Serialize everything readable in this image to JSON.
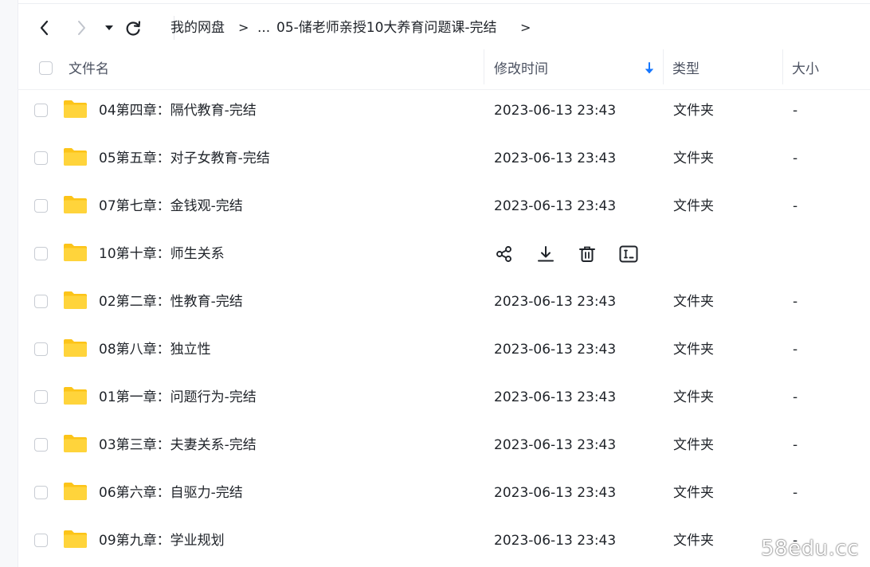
{
  "breadcrumb": {
    "root": "我的网盘",
    "sep1": ">",
    "ellipsis": "...",
    "current": "05-储老师亲授10大养育问题课-完结",
    "sep2": ">"
  },
  "nav": {
    "back_icon": "chevron-left-icon",
    "forward_icon": "chevron-right-icon",
    "dropdown_icon": "caret-down-icon",
    "refresh_icon": "refresh-icon"
  },
  "columns": {
    "name": "文件名",
    "modified": "修改时间",
    "type": "类型",
    "size": "大小",
    "sort_icon": "arrow-down-icon"
  },
  "files": [
    {
      "name": "04第四章：隔代教育-完结",
      "modified": "2023-06-13 23:43",
      "type": "文件夹",
      "size": "-"
    },
    {
      "name": "05第五章：对子女教育-完结",
      "modified": "2023-06-13 23:43",
      "type": "文件夹",
      "size": "-"
    },
    {
      "name": "07第七章：金钱观-完结",
      "modified": "2023-06-13 23:43",
      "type": "文件夹",
      "size": "-"
    },
    {
      "name": "10第十章：师生关系",
      "modified": "",
      "type": "",
      "size": "",
      "hovered": true
    },
    {
      "name": "02第二章：性教育-完结",
      "modified": "2023-06-13 23:43",
      "type": "文件夹",
      "size": "-"
    },
    {
      "name": "08第八章：独立性",
      "modified": "2023-06-13 23:43",
      "type": "文件夹",
      "size": "-"
    },
    {
      "name": "01第一章：问题行为-完结",
      "modified": "2023-06-13 23:43",
      "type": "文件夹",
      "size": "-"
    },
    {
      "name": "03第三章：夫妻关系-完结",
      "modified": "2023-06-13 23:43",
      "type": "文件夹",
      "size": "-"
    },
    {
      "name": "06第六章：自驱力-完结",
      "modified": "2023-06-13 23:43",
      "type": "文件夹",
      "size": "-"
    },
    {
      "name": "09第九章：学业规划",
      "modified": "2023-06-13 23:43",
      "type": "文件夹",
      "size": "-"
    }
  ],
  "row_actions": [
    "share-icon",
    "download-icon",
    "delete-icon",
    "rename-icon"
  ],
  "colors": {
    "folder": "#ffd43b",
    "folder_back": "#fcc419",
    "sort_arrow": "#1677ff"
  },
  "watermark": "58edu.cc"
}
